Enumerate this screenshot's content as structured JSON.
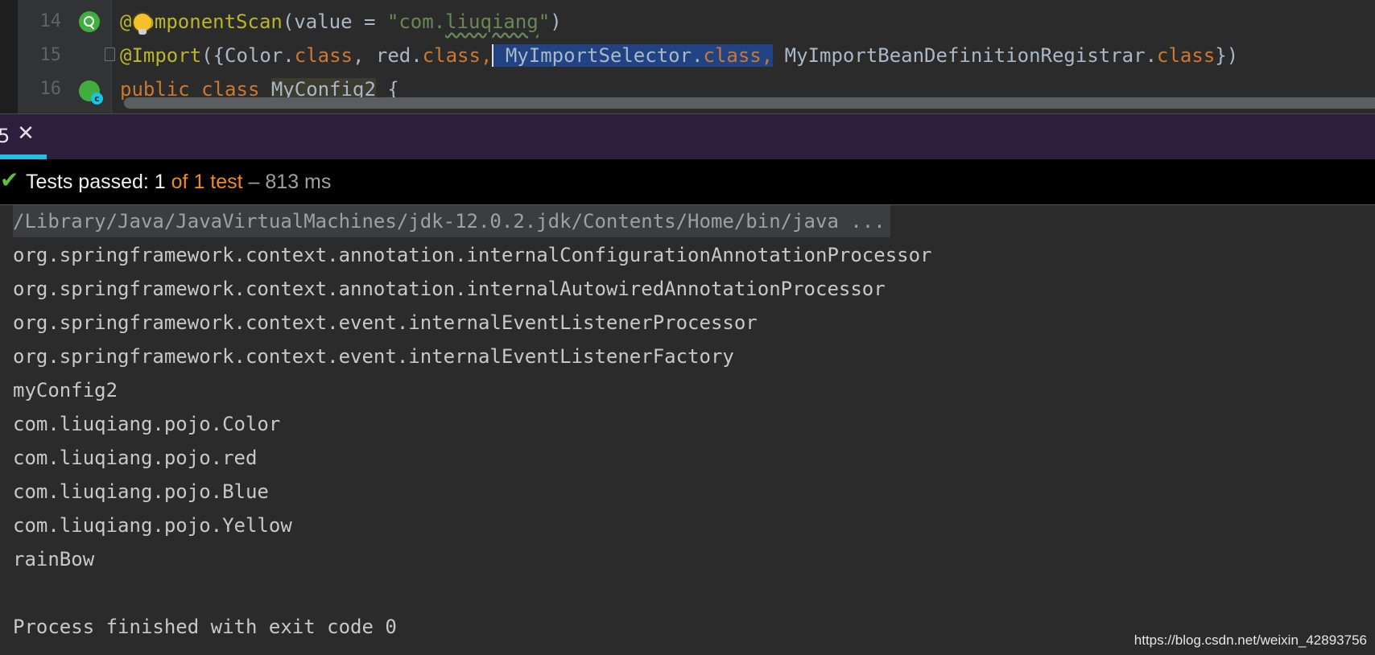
{
  "editor": {
    "line_numbers": [
      "14",
      "15",
      "16"
    ],
    "line14": {
      "at": "@",
      "annotation_rest": "omponentScan",
      "paren_open": "(value = ",
      "str_open": "\"com.",
      "str_squiggle": "liuqiang",
      "str_close": "\"",
      "paren_close": ")"
    },
    "line15": {
      "annotation": "@Import",
      "t1": "({Color.",
      "k1": "class",
      "t2": ", red.",
      "k2": "class",
      "t3": ",",
      "sel_cls": " MyImportSelector.",
      "sel_kw": "class,",
      "t4": " MyImportBeanDefinitionRegistrar.",
      "k3": "class",
      "t5": "})"
    },
    "line16": {
      "kw_public": "public",
      "kw_class": "class",
      "class_name": "MyConfig2",
      "brace": "{"
    }
  },
  "run_tab": {
    "label_fragment": "5",
    "close_symbol": "✕"
  },
  "status": {
    "icon": "checkmark-icon",
    "passed_label": "Tests passed: 1 ",
    "count_label": "of 1 test",
    "time_label": " – 813 ms",
    "colors": {
      "passed": "#5fbf3f",
      "count": "#f28a1a"
    }
  },
  "console": {
    "command": "/Library/Java/JavaVirtualMachines/jdk-12.0.2.jdk/Contents/Home/bin/java ...",
    "lines": [
      "org.springframework.context.annotation.internalConfigurationAnnotationProcessor",
      "org.springframework.context.annotation.internalAutowiredAnnotationProcessor",
      "org.springframework.context.event.internalEventListenerProcessor",
      "org.springframework.context.event.internalEventListenerFactory",
      "myConfig2",
      "com.liuqiang.pojo.Color",
      "com.liuqiang.pojo.red",
      "com.liuqiang.pojo.Blue",
      "com.liuqiang.pojo.Yellow",
      "rainBow"
    ],
    "finish": "Process finished with exit code 0"
  },
  "watermark": "https://blog.csdn.net/weixin_42893756"
}
